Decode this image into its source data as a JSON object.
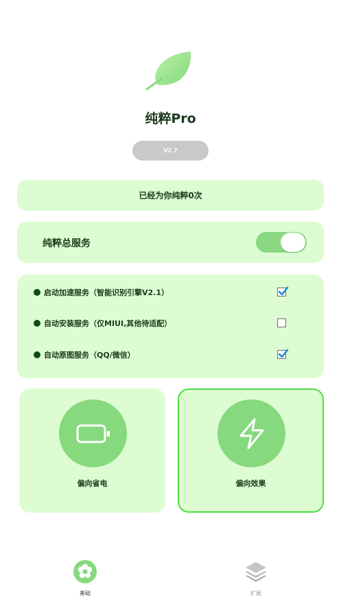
{
  "app": {
    "title": "纯粹Pro",
    "version": "V2.7"
  },
  "counter": {
    "text": "已经为你纯粹0次"
  },
  "main_service": {
    "label": "纯粹总服务",
    "enabled": true
  },
  "options": [
    {
      "label": "启动加速服务（智能识别引擎V2.1）",
      "checked": true
    },
    {
      "label": "自动安装服务（仅MIUI,其他待适配）",
      "checked": false
    },
    {
      "label": "自动原图服务（QQ/微信）",
      "checked": true
    }
  ],
  "modes": [
    {
      "label": "偏向省电",
      "icon": "battery-icon",
      "selected": false
    },
    {
      "label": "偏向效果",
      "icon": "lightning-icon",
      "selected": true
    }
  ],
  "nav": [
    {
      "label": "基础",
      "icon": "flower-icon",
      "active": true
    },
    {
      "label": "扩展",
      "icon": "layers-icon",
      "active": false
    }
  ],
  "colors": {
    "card_bg": "#ddfcd2",
    "accent": "#86d97d",
    "selected_border": "#4fdc3e",
    "toggle_on": "#8ad882",
    "check_blue": "#1a8fd1"
  }
}
